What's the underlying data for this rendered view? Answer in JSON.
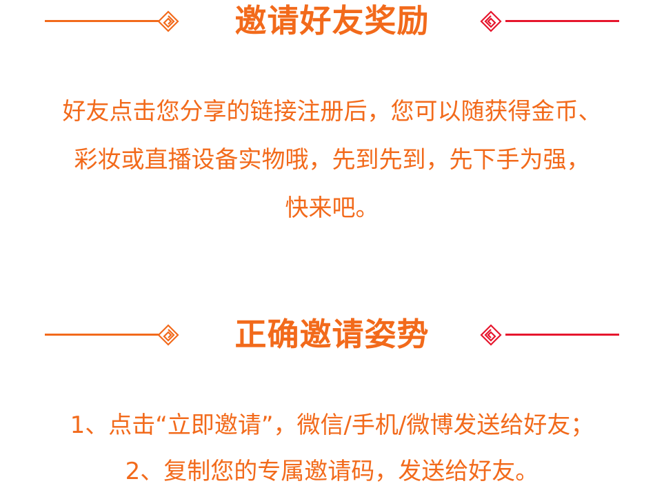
{
  "colors": {
    "text": "#f26a1b",
    "line_left": "#f26a1b",
    "line_right": "#e6162d"
  },
  "section1": {
    "title": "邀请好友奖励",
    "lines": [
      "好友点击您分享的链接注册后，您可以随获得金币、",
      "彩妆或直播设备实物哦，先到先到，先下手为强，",
      "快来吧。"
    ]
  },
  "section2": {
    "title": "正确邀请姿势",
    "lines": [
      "1、点击“立即邀请”，微信/手机/微博发送给好友；",
      "2、复制您的专属邀请码，发送给好友。"
    ]
  },
  "icons": {
    "left": "diamond-knot-icon",
    "right": "diamond-knot-icon"
  }
}
